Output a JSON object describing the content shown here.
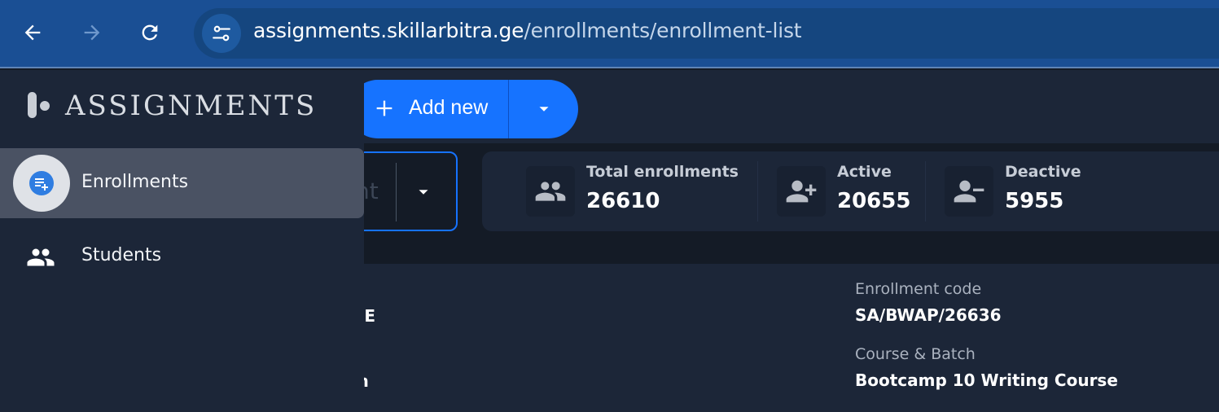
{
  "browser": {
    "url_host": "assignments.skillarbitra.ge",
    "url_path": "/enrollments/enrollment-list",
    "back_icon": "arrow-left-icon",
    "forward_icon": "arrow-right-icon",
    "reload_icon": "reload-icon",
    "site_info_icon": "tune-icon"
  },
  "sidebar": {
    "brand": "ASSIGNMENTS",
    "items": [
      {
        "label": "Enrollments",
        "icon": "playlist-add-icon",
        "active": true
      },
      {
        "label": "Students",
        "icon": "people-icon",
        "active": false
      }
    ]
  },
  "toolbar": {
    "add_new_label": "Add new",
    "select_placeholder": "nt"
  },
  "stats": [
    {
      "title": "Total enrollments",
      "value": "26610",
      "icon": "group-icon"
    },
    {
      "title": "Active",
      "value": "20655",
      "icon": "person-add-icon"
    },
    {
      "title": "Deactive",
      "value": "5955",
      "icon": "person-remove-icon"
    }
  ],
  "detail": {
    "left_value_1": "RE",
    "left_value_2": "m",
    "enrollment_code_label": "Enrollment code",
    "enrollment_code_value": "SA/BWAP/26636",
    "course_batch_label": "Course & Batch",
    "course_batch_value": "Bootcamp 10 Writing Course"
  },
  "colors": {
    "browser_bar": "#1a4f94",
    "accent": "#1673ff",
    "panel": "#1c2638",
    "background": "#141b26",
    "sidebar_active": "#4a5263"
  }
}
